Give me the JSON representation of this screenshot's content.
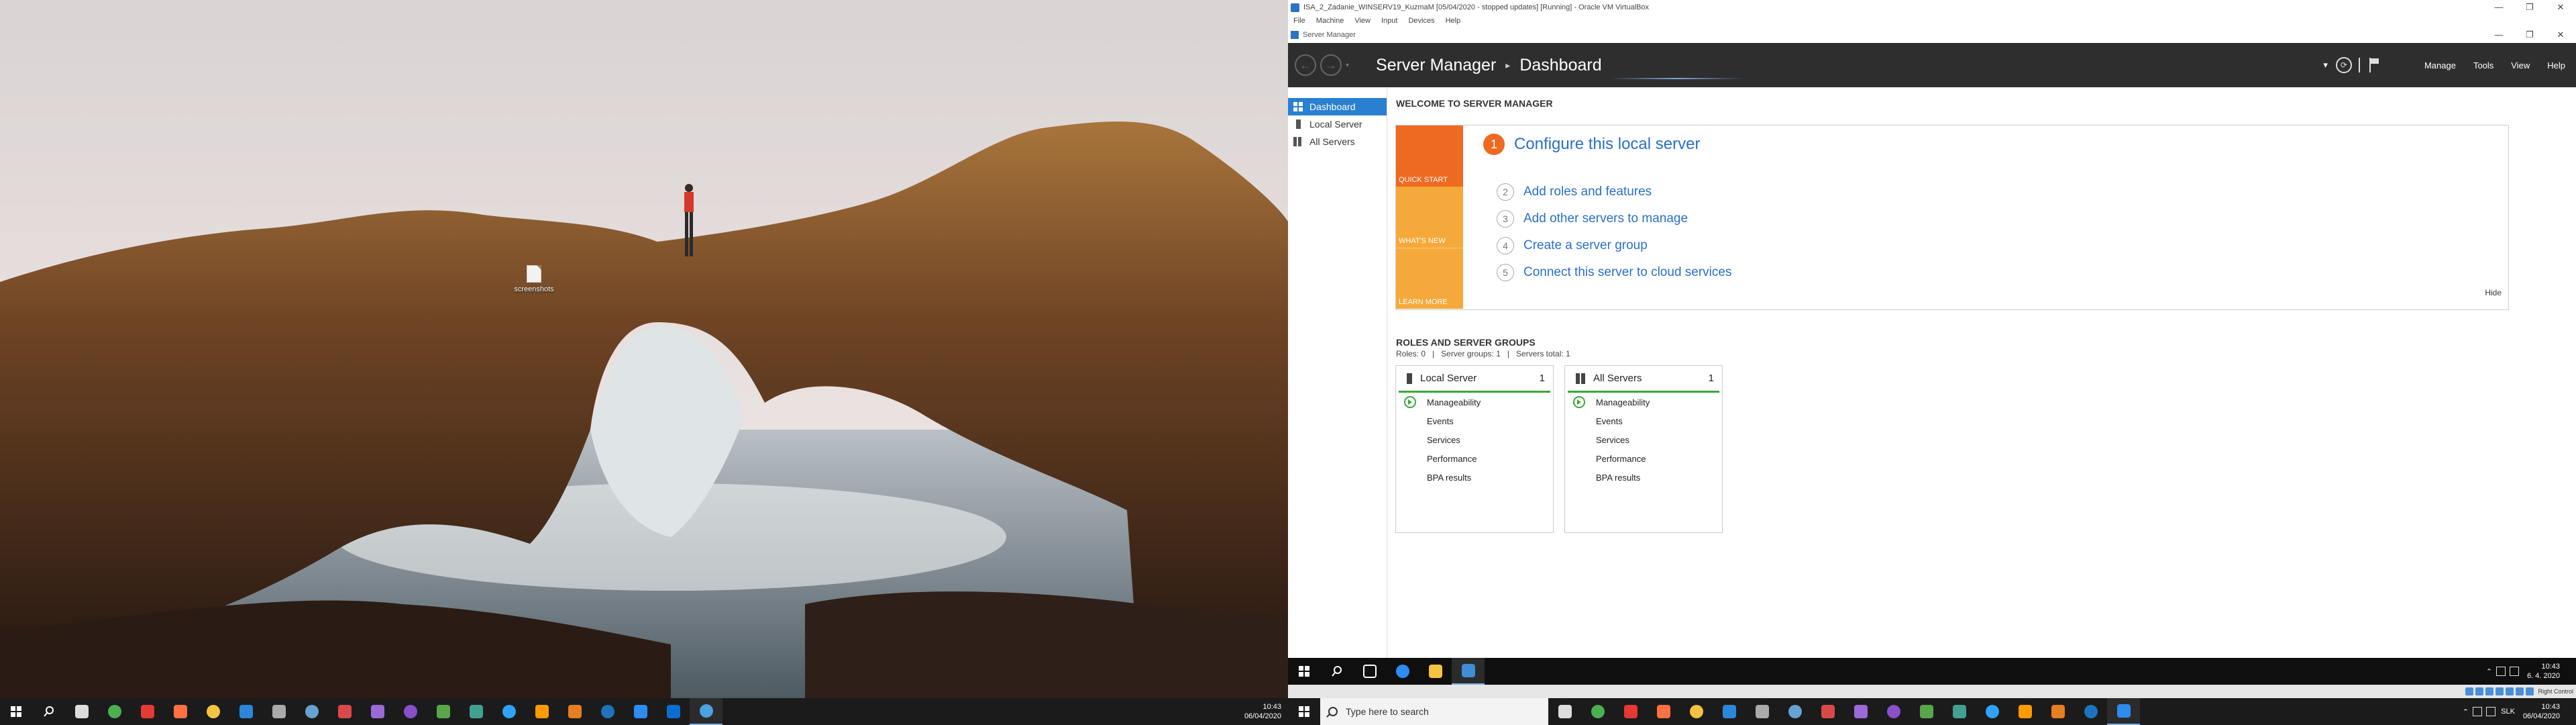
{
  "host": {
    "desktop_icon_label": "screenshots",
    "taskbar": {
      "time": "10:43",
      "date": "06/04/2020",
      "apps": [
        {
          "icon": "task-view-icon",
          "color": "#dddddd"
        },
        {
          "icon": "chrome-icon",
          "color": "#4caf50"
        },
        {
          "icon": "opera-icon",
          "color": "#e53935"
        },
        {
          "icon": "firefox-icon",
          "color": "#ff7043"
        },
        {
          "icon": "file-explorer-icon",
          "color": "#f5c342"
        },
        {
          "icon": "mail-icon",
          "color": "#2b88d8"
        },
        {
          "icon": "obs-icon",
          "color": "#aaaaaa"
        },
        {
          "icon": "steam-icon",
          "color": "#66a3d2"
        },
        {
          "icon": "app-red-icon",
          "color": "#d84a4a"
        },
        {
          "icon": "app-purple-icon",
          "color": "#9c6ad6"
        },
        {
          "icon": "app-violet-icon",
          "color": "#8a4fc9"
        },
        {
          "icon": "app-green-icon",
          "color": "#57a64a"
        },
        {
          "icon": "app-teal-icon",
          "color": "#43a08f"
        },
        {
          "icon": "photoshop-icon",
          "color": "#2fa3f7"
        },
        {
          "icon": "illustrator-icon",
          "color": "#ff9a00"
        },
        {
          "icon": "app-orange-icon",
          "color": "#e67e22"
        },
        {
          "icon": "virtualbox-icon",
          "color": "#1e73be"
        },
        {
          "icon": "app-blue-icon",
          "color": "#2d8cf0"
        },
        {
          "icon": "outlook-icon",
          "color": "#0a6ed1"
        },
        {
          "icon": "app-active-icon",
          "color": "#4aa3df"
        }
      ]
    }
  },
  "vbox": {
    "title": "ISA_2_Zadanie_WINSERV19_KuzmaM [05/04/2020 - stopped updates] [Running] - Oracle VM VirtualBox",
    "menu": [
      "File",
      "Machine",
      "View",
      "Input",
      "Devices",
      "Help"
    ],
    "min": "—",
    "max": "❐",
    "close": "✕"
  },
  "sm": {
    "window_title": "Server Manager",
    "breadcrumb_root": "Server Manager",
    "breadcrumb_sep": "▸",
    "breadcrumb_current": "Dashboard",
    "menu": {
      "manage": "Manage",
      "tools": "Tools",
      "view": "View",
      "help": "Help"
    },
    "nav": [
      {
        "label": "Dashboard"
      },
      {
        "label": "Local Server"
      },
      {
        "label": "All Servers"
      }
    ],
    "welcome": {
      "title": "WELCOME TO SERVER MANAGER",
      "quick_start": "QUICK START",
      "whats_new": "WHAT'S NEW",
      "learn_more": "LEARN MORE",
      "step1_num": "1",
      "step1": "Configure this local server",
      "steps": [
        {
          "num": "2",
          "label": "Add roles and features"
        },
        {
          "num": "3",
          "label": "Add other servers to manage"
        },
        {
          "num": "4",
          "label": "Create a server group"
        },
        {
          "num": "5",
          "label": "Connect this server to cloud services"
        }
      ],
      "hide": "Hide"
    },
    "roles": {
      "title": "ROLES AND SERVER GROUPS",
      "roles_count": "Roles: 0",
      "groups_count": "Server groups: 1",
      "servers_total": "Servers total: 1",
      "sep": "|",
      "tiles": [
        {
          "name": "Local Server",
          "count": "1",
          "rows": [
            "Manageability",
            "Events",
            "Services",
            "Performance",
            "BPA results"
          ]
        },
        {
          "name": "All Servers",
          "count": "1",
          "rows": [
            "Manageability",
            "Events",
            "Services",
            "Performance",
            "BPA results"
          ]
        }
      ]
    }
  },
  "vm_taskbar": {
    "time": "10:43",
    "date": "6. 4. 2020"
  },
  "host2_taskbar": {
    "search_placeholder": "Type here to search",
    "time": "10:43",
    "date": "06/04/2020",
    "lang": "SLK",
    "host_key": "Right Control"
  }
}
